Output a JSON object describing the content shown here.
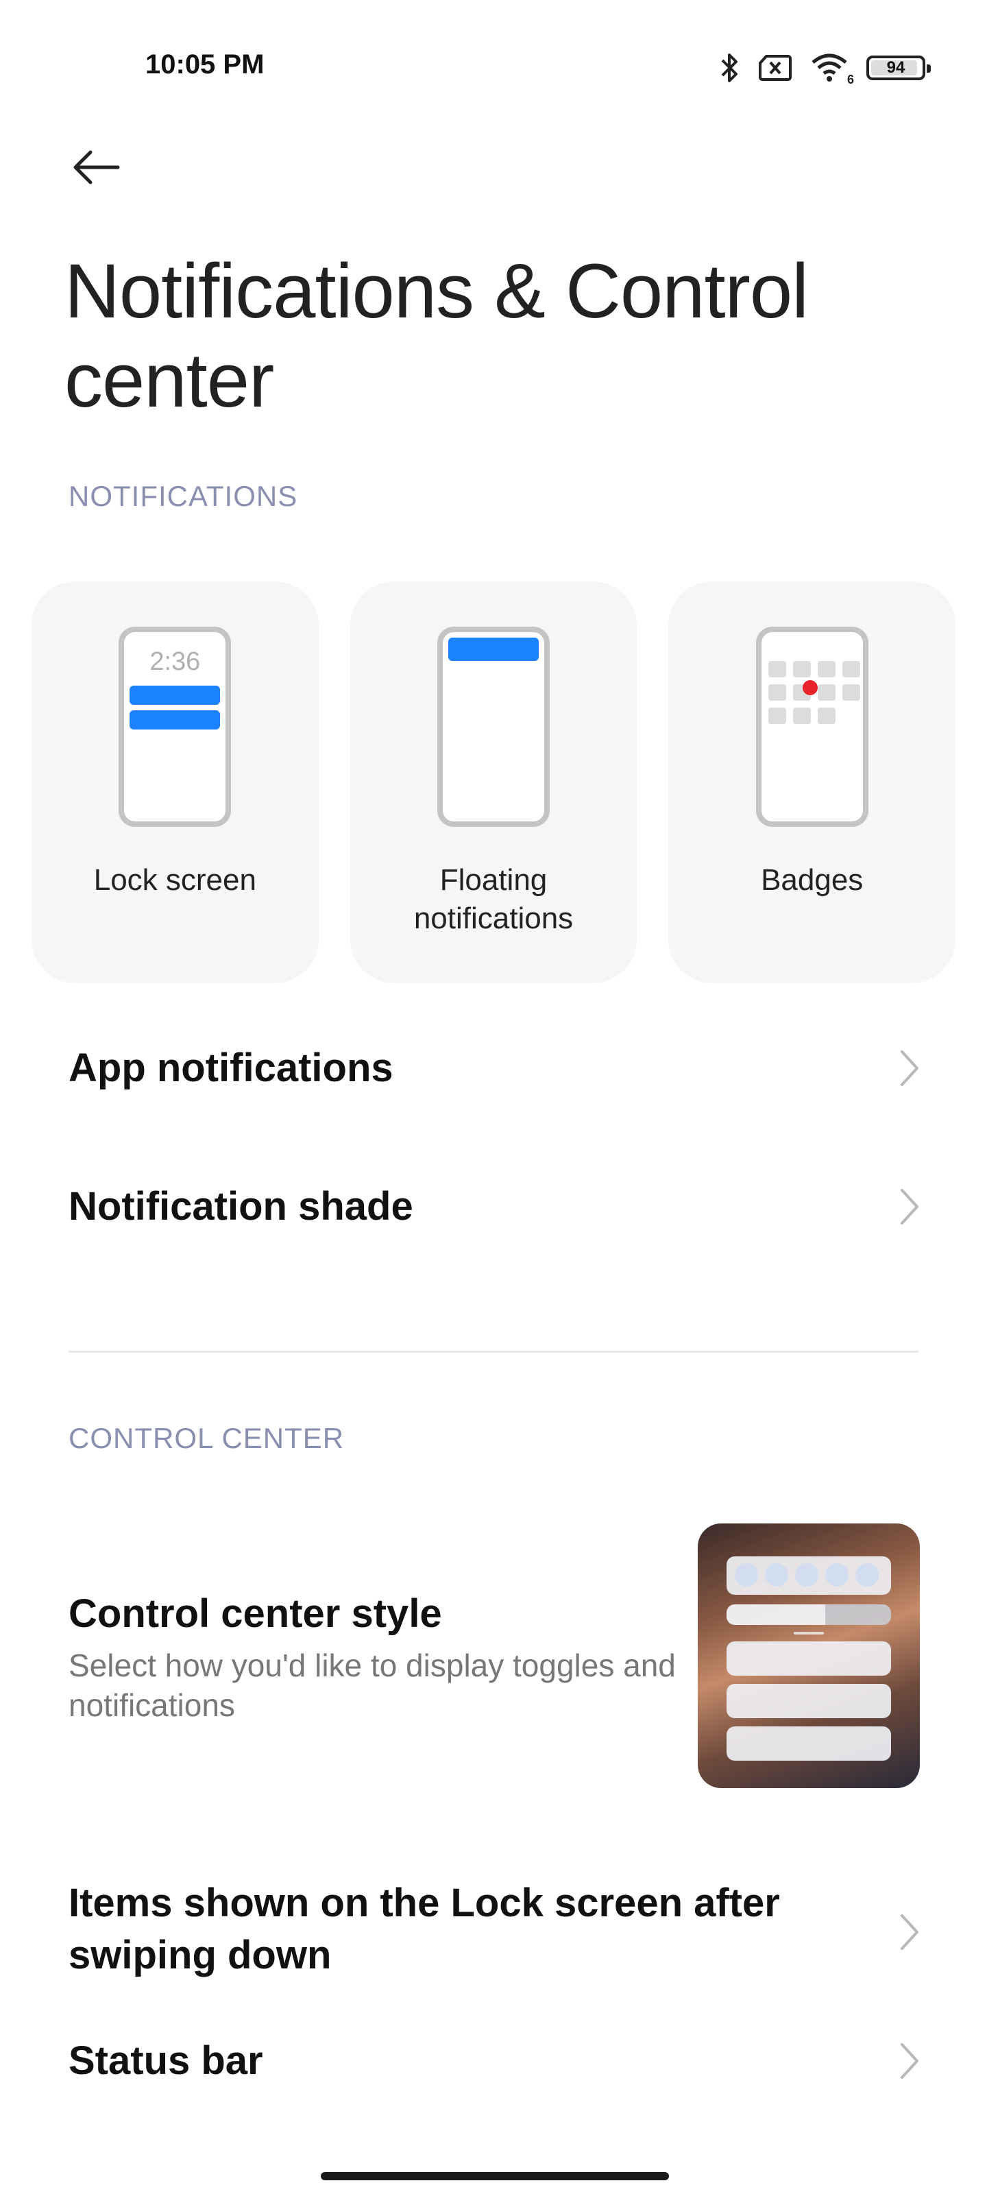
{
  "status_bar": {
    "time": "10:05 PM",
    "battery": "94",
    "battery_level": 0.94,
    "wifi_label": "6",
    "icons": [
      "bluetooth-icon",
      "no-sim-icon",
      "wifi-icon",
      "battery-icon"
    ]
  },
  "header": {
    "title": "Notifications & Control center"
  },
  "notifications_section": {
    "label": "NOTIFICATIONS",
    "cards": [
      {
        "label": "Lock screen",
        "preview_time": "2:36"
      },
      {
        "label": "Floating notifications"
      },
      {
        "label": "Badges"
      }
    ],
    "items": [
      {
        "label": "App notifications"
      },
      {
        "label": "Notification shade"
      }
    ]
  },
  "control_center_section": {
    "label": "CONTROL CENTER",
    "style_item": {
      "label": "Control center style",
      "description": "Select how you'd like to display toggles and notifications"
    },
    "items": [
      {
        "label": "Items shown on the Lock screen after swiping down"
      },
      {
        "label": "Status bar"
      }
    ]
  },
  "colors": {
    "accent_blue": "#1a82ff",
    "section_header": "#8a8fb0",
    "badge_red": "#e8232b",
    "card_bg": "#f6f6f6"
  }
}
